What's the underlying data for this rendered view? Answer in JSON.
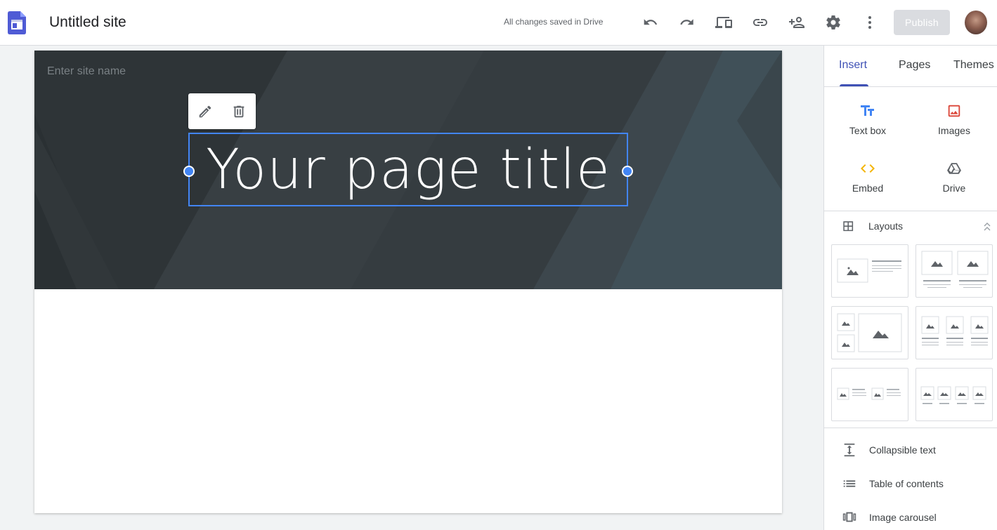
{
  "app": {
    "title": "Untitled site",
    "save_status": "All changes saved in Drive",
    "publish_label": "Publish",
    "toolbar_icons": [
      "undo-icon",
      "redo-icon",
      "preview-icon",
      "link-icon",
      "share-icon",
      "gear-icon",
      "more-vert-icon"
    ]
  },
  "page": {
    "site_name_placeholder": "Enter site name",
    "title": "Your page title",
    "selection_color": "#4285f4",
    "hero_color": "#333a3e"
  },
  "panel": {
    "tabs": [
      {
        "label": "Insert",
        "active": true
      },
      {
        "label": "Pages",
        "active": false
      },
      {
        "label": "Themes",
        "active": false
      }
    ],
    "insert_items": [
      {
        "label": "Text box",
        "icon": "text-box-icon",
        "color": "#4285f4"
      },
      {
        "label": "Images",
        "icon": "image-icon",
        "color": "#db4437"
      },
      {
        "label": "Embed",
        "icon": "embed-icon",
        "color": "#f4b400"
      },
      {
        "label": "Drive",
        "icon": "drive-icon",
        "color": "#5f6368"
      }
    ],
    "layouts_label": "Layouts",
    "layout_count": 6,
    "components": [
      {
        "label": "Collapsible text",
        "icon": "collapsible-text-icon"
      },
      {
        "label": "Table of contents",
        "icon": "table-of-contents-icon"
      },
      {
        "label": "Image carousel",
        "icon": "image-carousel-icon"
      }
    ]
  }
}
